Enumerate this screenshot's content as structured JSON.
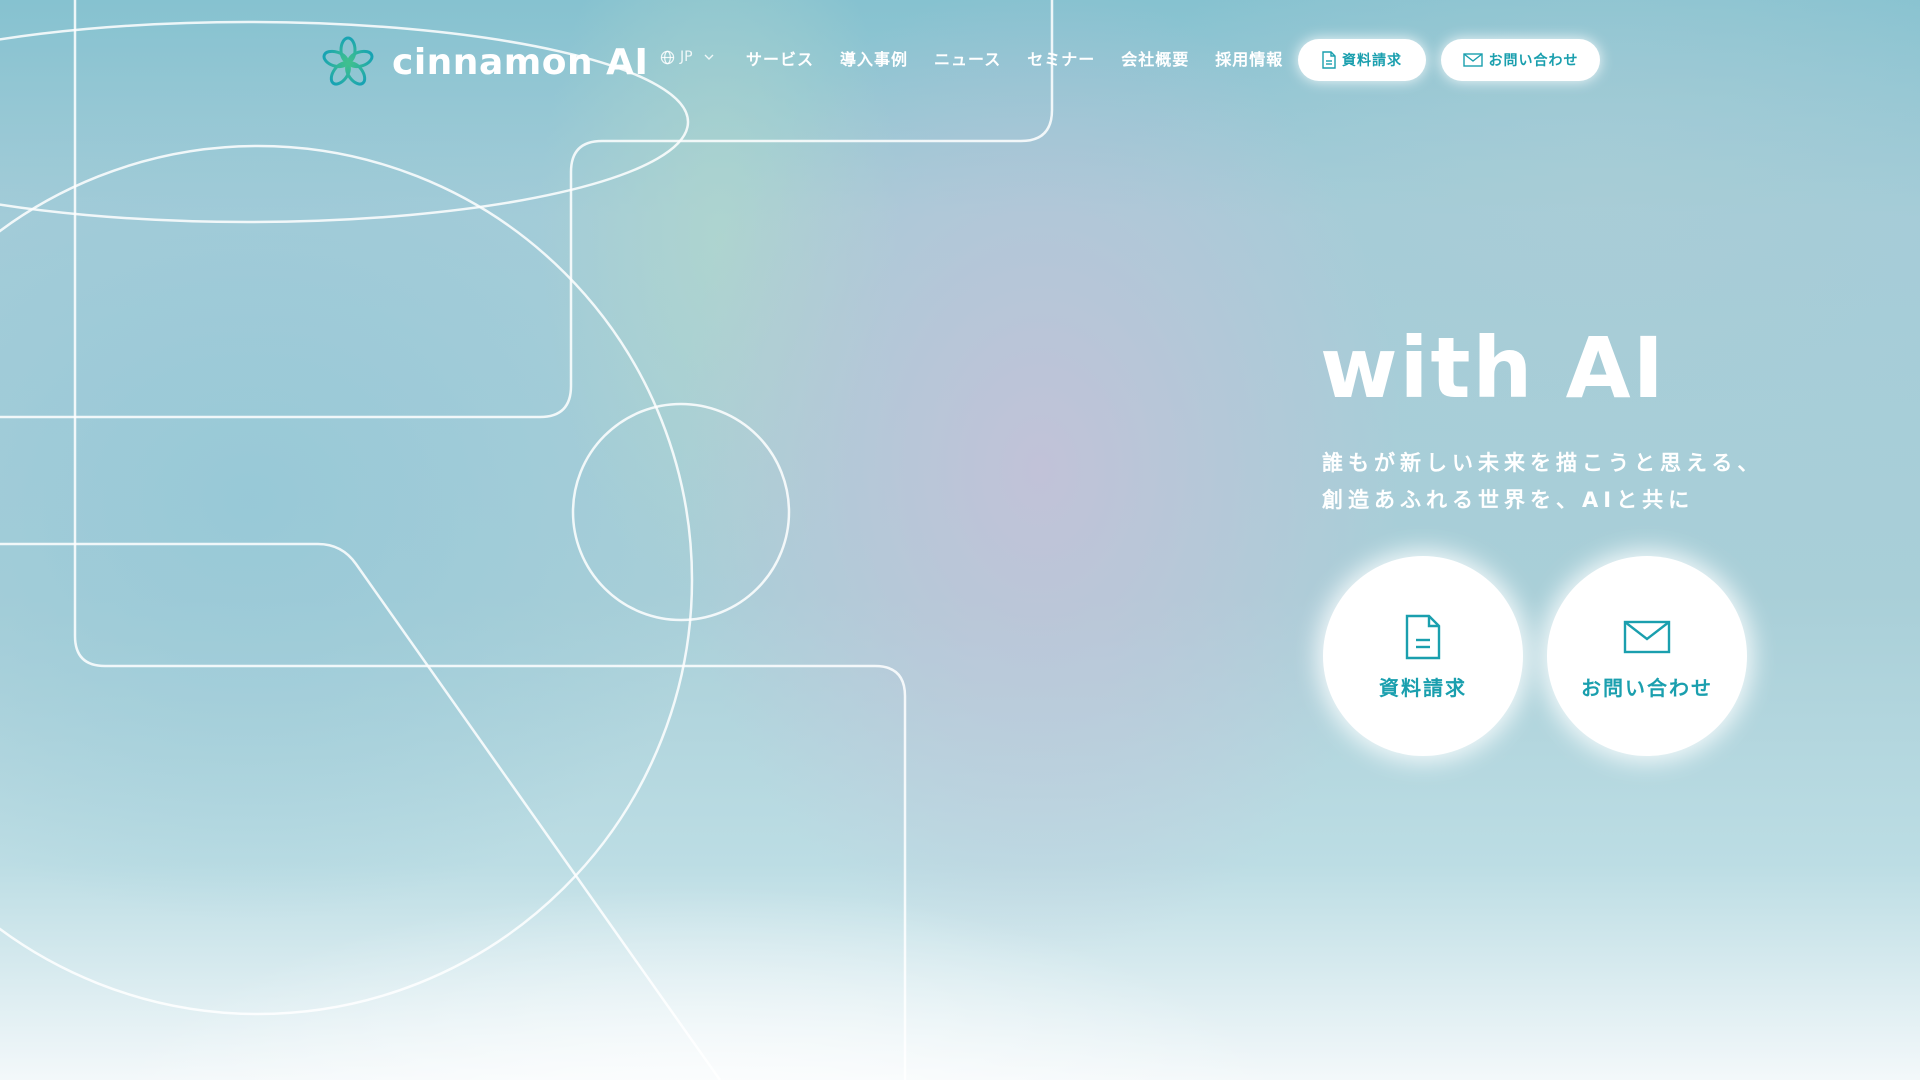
{
  "brand": {
    "name": "cinnamon AI",
    "colors": {
      "accent": "#1a9fae",
      "logo_teal": "#17a3b3",
      "logo_green": "#3fbf8f",
      "white": "#ffffff"
    }
  },
  "header": {
    "language": {
      "label": "JP",
      "icon": "globe-icon"
    },
    "nav": [
      {
        "label": "サービス"
      },
      {
        "label": "導入事例"
      },
      {
        "label": "ニュース"
      },
      {
        "label": "セミナー"
      },
      {
        "label": "会社概要"
      },
      {
        "label": "採用情報"
      }
    ],
    "doc_button": {
      "label": "資料請求",
      "icon": "document-icon"
    },
    "contact_button": {
      "label": "お問い合わせ",
      "icon": "mail-icon"
    }
  },
  "hero": {
    "title": "with AI",
    "copy_line1": "誰もが新しい未来を描こうと思える、",
    "copy_line2": "創造あふれる世界を、AIと共に",
    "doc_button": {
      "label": "資料請求",
      "icon": "document-icon"
    },
    "contact_button": {
      "label": "お問い合わせ",
      "icon": "mail-icon"
    }
  }
}
